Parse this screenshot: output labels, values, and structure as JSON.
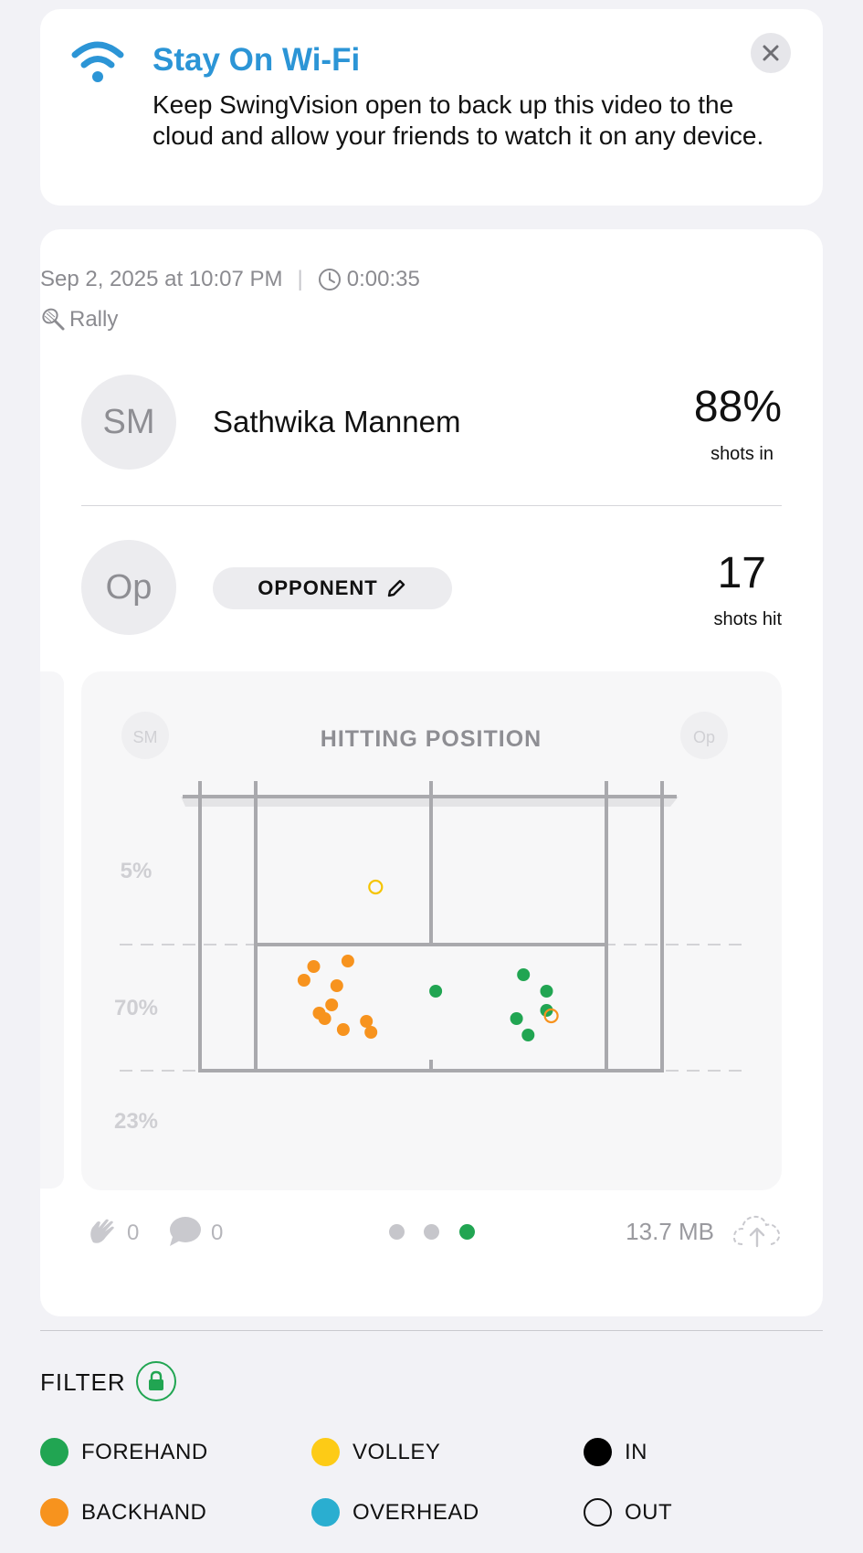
{
  "banner": {
    "title": "Stay On Wi-Fi",
    "body": "Keep SwingVision open to back up this video to the cloud and allow your friends to watch it on any device.",
    "icon": "wifi-icon",
    "accent": "#2c95d6"
  },
  "session": {
    "date": "Sep 2, 2025 at 10:07 PM",
    "separator": "|",
    "duration": "0:00:35",
    "type": "Rally",
    "player": {
      "initials": "SM",
      "name": "Sathwika Mannem",
      "stat_value": "88%",
      "stat_label": "shots in"
    },
    "opponent": {
      "initials": "Op",
      "button_label": "OPPONENT",
      "stat_value": "17",
      "stat_label": "shots hit"
    },
    "claps": "0",
    "comments": "0",
    "file_size": "13.7 MB",
    "pages": 3,
    "current_page": 3
  },
  "chart_data": {
    "type": "scatter",
    "title": "HITTING POSITION",
    "corner_left": "SM",
    "corner_right": "Op",
    "zone_labels": [
      "5%",
      "70%",
      "23%"
    ],
    "grid": false,
    "legend": "none",
    "series": [
      {
        "name": "FOREHAND",
        "color": "#21a552",
        "filled": true,
        "points": [
          [
            0.51,
            0.29
          ],
          [
            0.685,
            0.19
          ],
          [
            0.71,
            0.13
          ],
          [
            0.75,
            0.22
          ],
          [
            0.75,
            0.29
          ],
          [
            0.7,
            0.35
          ]
        ]
      },
      {
        "name": "BACKHAND",
        "color": "#f7931e",
        "filled": true,
        "points": [
          [
            0.246,
            0.38
          ],
          [
            0.258,
            0.21
          ],
          [
            0.36,
            0.18
          ],
          [
            0.37,
            0.14
          ],
          [
            0.27,
            0.19
          ],
          [
            0.285,
            0.24
          ],
          [
            0.31,
            0.15
          ],
          [
            0.32,
            0.4
          ],
          [
            0.225,
            0.33
          ],
          [
            0.296,
            0.31
          ]
        ]
      },
      {
        "name": "BACKHAND",
        "color": "#f7931e",
        "filled": false,
        "points": [
          [
            0.76,
            0.2
          ]
        ]
      },
      {
        "name": "VOLLEY",
        "color": "#f5c400",
        "filled": false,
        "points": [
          [
            0.38,
            0.67
          ]
        ]
      }
    ]
  },
  "filter": {
    "title": "FILTER",
    "items": [
      {
        "label": "FOREHAND",
        "color": "#21a552",
        "style": "filled"
      },
      {
        "label": "VOLLEY",
        "color": "#fdcb16",
        "style": "filled"
      },
      {
        "label": "IN",
        "color": "#000000",
        "style": "filled"
      },
      {
        "label": "BACKHAND",
        "color": "#f7931e",
        "style": "filled"
      },
      {
        "label": "OVERHEAD",
        "color": "#2aaed0",
        "style": "filled"
      },
      {
        "label": "OUT",
        "color": "#111111",
        "style": "outline"
      }
    ]
  }
}
